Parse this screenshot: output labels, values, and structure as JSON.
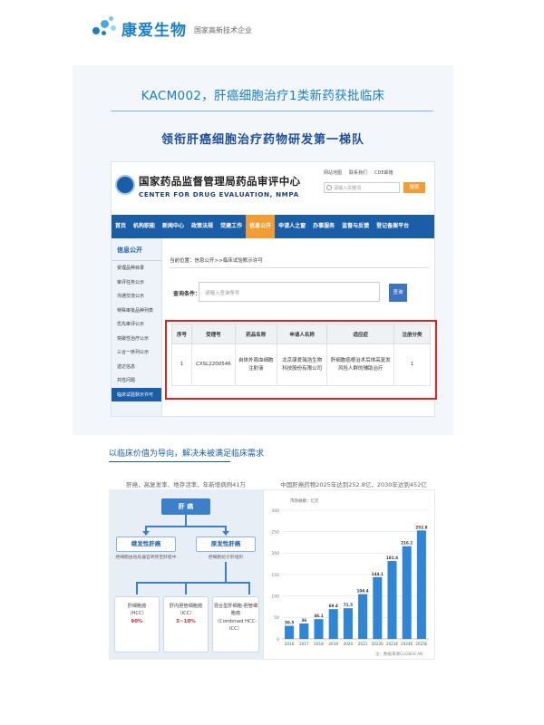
{
  "header": {
    "brand": "康爱生物",
    "tagline": "国家高新技术企业"
  },
  "main_title": "KACM002，肝癌细胞治疗1类新药获批临床",
  "sub_title": "领衔肝癌细胞治疗药物研发第一梯队",
  "cde": {
    "name_cn": "国家药品监督管理局药品审评中心",
    "name_en": "CENTER FOR DRUG EVALUATION, NMPA",
    "top_links": [
      "网站地图",
      "联系我们",
      "CDE邮箱"
    ],
    "search_placeholder": "请输入关键词",
    "search_button": "搜索",
    "nav": [
      "首页",
      "机构职能",
      "新闻中心",
      "政策法规",
      "党建工作",
      "信息公开",
      "申请人之窗",
      "办事服务",
      "监督与反馈",
      "登记备案平台"
    ],
    "side_head": "信息公开",
    "side_items": [
      "受理品种目录",
      "审评任务公示",
      "沟通交流公示",
      "特殊审批品种列表",
      "优先审评公示",
      "突破性治疗公示",
      "三合一序列公示",
      "送达信息",
      "共性问题",
      "临床试验默示许可"
    ],
    "breadcrumb": "当前位置：信息公开>>临床试验默示许可",
    "query_label": "查询条件：",
    "query_placeholder": "请输入查询条件",
    "query_button": "查询",
    "table_headers": [
      "序号",
      "受理号",
      "药品名称",
      "申请人名称",
      "适应症",
      "注册分类"
    ],
    "table_rows": [
      [
        "1",
        "CXSL2200546",
        "自体外周血细胞注射液",
        "北京康爱瑞浩生物科技股份有限公司",
        "肝细胞癌根治术后体高复发风险人群的辅助治疗",
        "1"
      ]
    ]
  },
  "section2": {
    "title": "以临床价值为导向，解决未被满足临床需求",
    "left_caption": "肝癌，高复发率、地存活率，年新增病例41万",
    "right_caption": "中国肝癌药物2025年达到252.8亿，2030年达到452亿"
  },
  "tree": {
    "root": "肝 癌",
    "branches": [
      {
        "label": "继发性肝癌",
        "desc": "癌细胞由他处器官转移至肝脏中"
      },
      {
        "label": "原发性肝癌",
        "desc": "癌细胞始于肝组织"
      }
    ],
    "leaves": [
      {
        "name": "肝细胞癌",
        "abbr": "（HCC）",
        "pct": "90%"
      },
      {
        "name": "肝内胆管细胞癌",
        "abbr": "（ICC）",
        "pct": "5~10%"
      },
      {
        "name": "混合型肝细胞-胆管细胞癌",
        "abbr": "（Combined HCC-ICC）",
        "pct": ""
      }
    ]
  },
  "chart_data": {
    "type": "bar",
    "title": "",
    "unit_label": "市场规模：亿元",
    "categories": [
      "2016",
      "2017",
      "2018",
      "2019",
      "2020",
      "2021",
      "2022E",
      "2023E",
      "2024E",
      "2025E"
    ],
    "values": [
      30.5,
      36.0,
      46.1,
      69.4,
      71.5,
      104.4,
      144.1,
      181.6,
      216.1,
      252.8
    ],
    "value_labels": [
      "30.5",
      "36",
      "46.1",
      "69.4",
      "71.5",
      "104.4",
      "144.1",
      "181.6",
      "216.1",
      "252.8"
    ],
    "ylim": [
      0,
      300
    ],
    "yticks": [
      0,
      50,
      100,
      150,
      200,
      250,
      300
    ],
    "bar_color": "#2f86d6",
    "note": "注：数据来源GLOBOCAN"
  }
}
